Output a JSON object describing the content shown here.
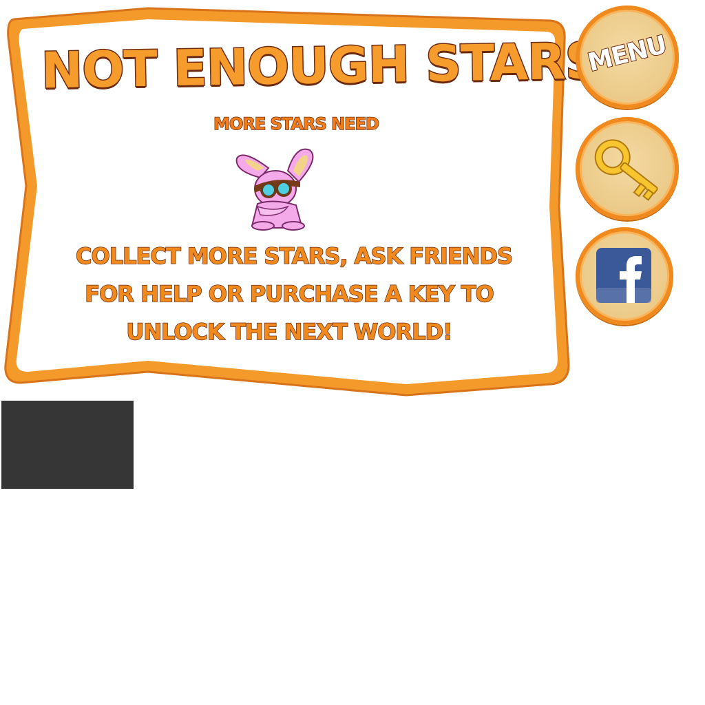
{
  "dialog": {
    "title": "NOT ENOUGH STARS!",
    "subtitle": "MORE STARS NEED",
    "message_lines": [
      "COLLECT MORE STARS, ASK FRIENDS",
      "FOR HELP OR PURCHASE A KEY TO",
      "UNLOCK THE NEXT WORLD!"
    ],
    "character_icon": "pink-bunny-with-goggles-icon"
  },
  "side_buttons": {
    "menu_label": "MENU",
    "key_icon": "golden-key-icon",
    "facebook_icon": "facebook-icon"
  },
  "colors": {
    "frame_orange": "#f39a2b",
    "text_orange": "#f59c2c",
    "outline_brown": "#6b2a10",
    "button_fill": "#eccb8a",
    "facebook_blue": "#3b5998",
    "dark_box": "#363636"
  }
}
